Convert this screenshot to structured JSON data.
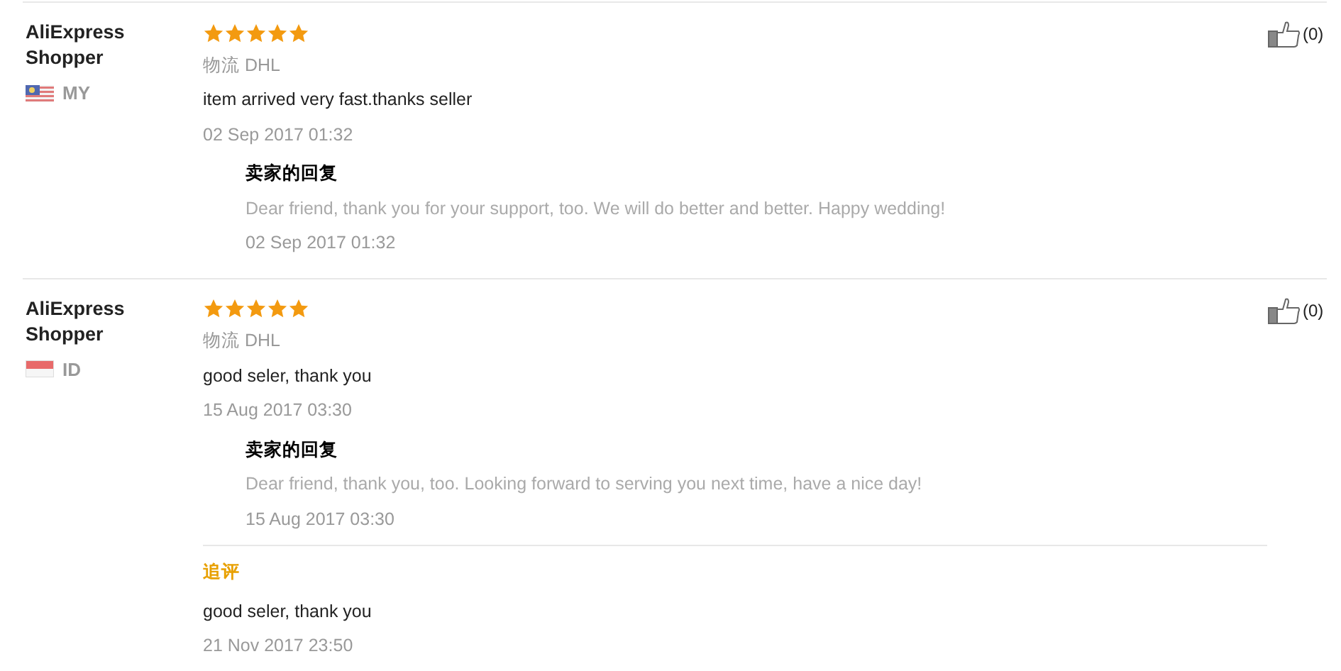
{
  "reviews": [
    {
      "name": "AliExpress Shopper",
      "country": "MY",
      "flag": {
        "kind": "stripes"
      },
      "stars": 5,
      "shipping": "物流 DHL",
      "text": "item arrived very fast.thanks seller",
      "date": "02 Sep 2017 01:32",
      "likes": "(0)",
      "reply": {
        "title": "卖家的回复",
        "text": "Dear friend, thank you for your support, too. We will do better and better. Happy wedding!",
        "date": "02 Sep 2017 01:32"
      }
    },
    {
      "name": "AliExpress Shopper",
      "country": "ID",
      "flag": {
        "kind": "bicolor"
      },
      "stars": 5,
      "shipping": "物流 DHL",
      "text": "good seler, thank you",
      "date": "15 Aug 2017 03:30",
      "likes": "(0)",
      "reply": {
        "title": "卖家的回复",
        "text": "Dear friend, thank you, too. Looking forward to serving you next time, have a nice day!",
        "date": "15 Aug 2017 03:30"
      },
      "followup": {
        "label": "追评",
        "text": "good seler, thank you",
        "date": "21 Nov 2017 23:50"
      }
    }
  ]
}
